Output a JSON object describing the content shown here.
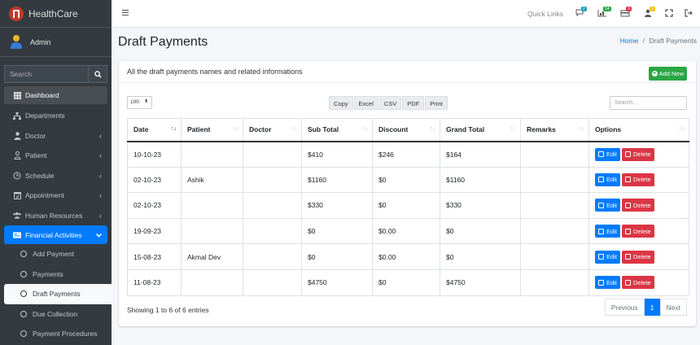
{
  "brand": {
    "name": "HealthCare"
  },
  "user": {
    "name": "Admin"
  },
  "sidebar": {
    "search_placeholder": "Search",
    "items": [
      {
        "label": "Dashboard"
      },
      {
        "label": "Departments"
      },
      {
        "label": "Doctor"
      },
      {
        "label": "Patient"
      },
      {
        "label": "Schedule"
      },
      {
        "label": "Appointment"
      },
      {
        "label": "Human Resources"
      },
      {
        "label": "Financial Activities"
      }
    ],
    "sub_items": [
      {
        "label": "Add Payment"
      },
      {
        "label": "Payments"
      },
      {
        "label": "Draft Payments"
      },
      {
        "label": "Due Collection"
      },
      {
        "label": "Payment Procedures"
      }
    ]
  },
  "topbar": {
    "quick_links": "Quick Links",
    "badges": [
      "2",
      "14",
      "3",
      "1"
    ],
    "colors": {
      "badge1": "#17a2b8",
      "badge2": "#28a745",
      "badge3": "#dc3545",
      "badge4": "#ffc107"
    }
  },
  "page": {
    "title": "Draft Payments",
    "breadcrumb_home": "Home",
    "breadcrumb_sep": "/",
    "breadcrumb_current": "Draft Payments"
  },
  "card": {
    "title": "All the draft payments names and related informations",
    "add_button": "Add New",
    "length_value": "100",
    "export_buttons": [
      "Copy",
      "Excel",
      "CSV",
      "PDF",
      "Print"
    ],
    "search_placeholder": "Search...",
    "columns": [
      "Date",
      "Patient",
      "Doctor",
      "Sub Total",
      "Discount",
      "Grand Total",
      "Remarks",
      "Options"
    ],
    "rows": [
      {
        "date": "10-10-23",
        "patient": "",
        "doctor": "",
        "sub_total": "$410",
        "discount": "$246",
        "grand_total": "$164",
        "remarks": ""
      },
      {
        "date": "02-10-23",
        "patient": "Ashik",
        "doctor": "",
        "sub_total": "$1160",
        "discount": "$0",
        "grand_total": "$1160",
        "remarks": ""
      },
      {
        "date": "02-10-23",
        "patient": "",
        "doctor": "",
        "sub_total": "$330",
        "discount": "$0",
        "grand_total": "$330",
        "remarks": ""
      },
      {
        "date": "19-09-23",
        "patient": "",
        "doctor": "",
        "sub_total": "$0",
        "discount": "$0.00",
        "grand_total": "$0",
        "remarks": ""
      },
      {
        "date": "15-08-23",
        "patient": "Akmal Dev",
        "doctor": "",
        "sub_total": "$0",
        "discount": "$0.00",
        "grand_total": "$0",
        "remarks": ""
      },
      {
        "date": "11-08-23",
        "patient": "",
        "doctor": "",
        "sub_total": "$4750",
        "discount": "$0",
        "grand_total": "$4750",
        "remarks": ""
      }
    ],
    "edit_label": "Edit",
    "delete_label": "Delete",
    "info": "Showing 1 to 6 of 6 entries",
    "pager": {
      "prev": "Previous",
      "page": "1",
      "next": "Next"
    }
  }
}
